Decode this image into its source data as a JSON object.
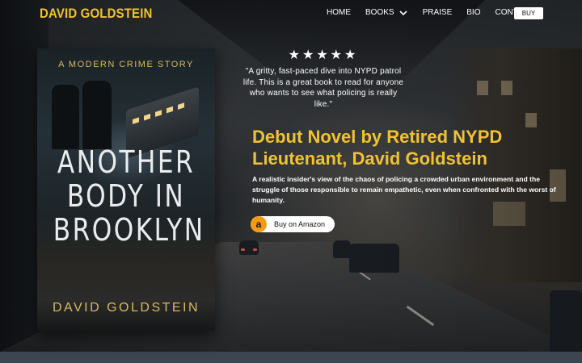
{
  "nav": {
    "brand": "DAVID GOLDSTEIN",
    "links": [
      "HOME",
      "BOOKS",
      "PRAISE",
      "BIO",
      "CONTACT"
    ],
    "buy": "BUY"
  },
  "book": {
    "tagline": "A MODERN CRIME STORY",
    "title_lines": [
      "ANOTHER",
      "BODY IN",
      "BROOKLYN"
    ],
    "author": "DAVID GOLDSTEIN"
  },
  "review": {
    "stars": "★★★★★",
    "rating": 5,
    "quote": "\"A gritty, fast-paced dive into NYPD patrol life. This is a great book to read for anyone who wants to see what policing is really like.\""
  },
  "hero": {
    "headline": "Debut Novel by Retired NYPD Lieutenant, David Goldstein",
    "description": "A realistic insider's view of the chaos of policing a crowded urban environment and the struggle of those responsible to remain empathetic, even when confronted with the worst of humanity."
  },
  "amazon": {
    "icon_letter": "a",
    "label": "Buy on Amazon"
  },
  "colors": {
    "accent": "#f2c230",
    "amazon": "#f39c12",
    "cover_text": "#d8b963"
  },
  "icons": {
    "books_dropdown": "chevron-down-icon",
    "amazon": "amazon-logo-icon"
  }
}
